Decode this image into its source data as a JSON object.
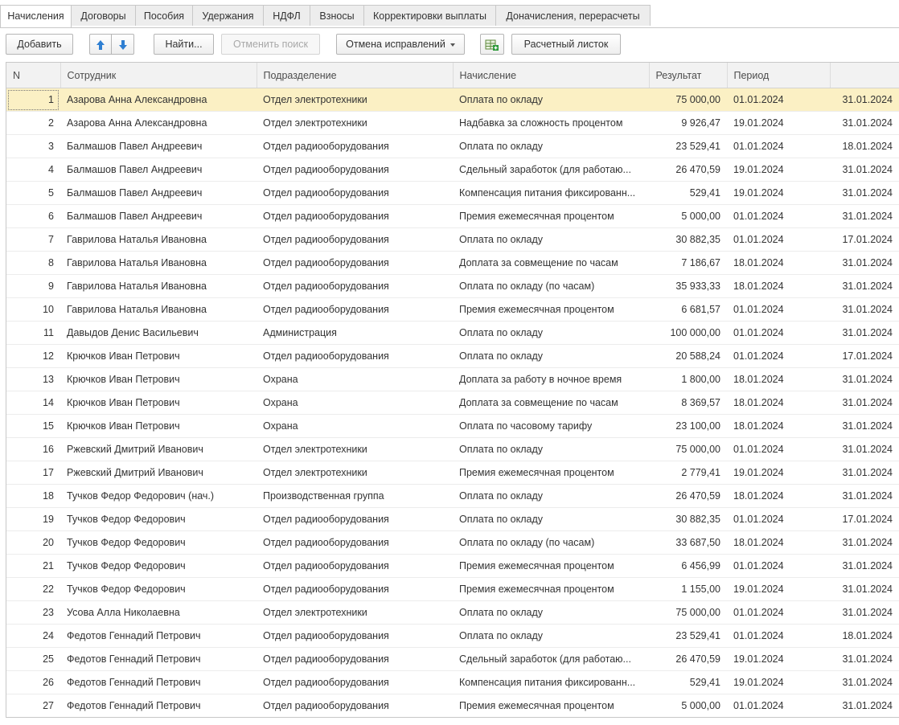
{
  "tabs": [
    "Начисления",
    "Договоры",
    "Пособия",
    "Удержания",
    "НДФЛ",
    "Взносы",
    "Корректировки выплаты",
    "Доначисления, перерасчеты"
  ],
  "toolbar": {
    "add": "Добавить",
    "find": "Найти...",
    "cancel_search": "Отменить поиск",
    "cancel_corrections": "Отмена исправлений",
    "payslip": "Расчетный листок",
    "icons": [
      "arrow-up-icon",
      "arrow-down-icon",
      "table-add-icon",
      "chevron-down-icon"
    ]
  },
  "columns": [
    "N",
    "Сотрудник",
    "Подразделение",
    "Начисление",
    "Результат",
    "Период",
    ""
  ],
  "colors": {
    "selected_row": "#fbf0c4",
    "arrow_blue": "#2f7fd2",
    "tab_bg": "#ededed"
  },
  "rows": [
    [
      "1",
      "Азарова Анна Александровна",
      "Отдел электротехники",
      "Оплата по окладу",
      "75 000,00",
      "01.01.2024",
      "31.01.2024"
    ],
    [
      "2",
      "Азарова Анна Александровна",
      "Отдел электротехники",
      "Надбавка за сложность процентом",
      "9 926,47",
      "19.01.2024",
      "31.01.2024"
    ],
    [
      "3",
      "Балмашов Павел Андреевич",
      "Отдел радиооборудования",
      "Оплата по окладу",
      "23 529,41",
      "01.01.2024",
      "18.01.2024"
    ],
    [
      "4",
      "Балмашов Павел Андреевич",
      "Отдел радиооборудования",
      "Сдельный заработок (для работаю...",
      "26 470,59",
      "19.01.2024",
      "31.01.2024"
    ],
    [
      "5",
      "Балмашов Павел Андреевич",
      "Отдел радиооборудования",
      "Компенсация питания фиксированн...",
      "529,41",
      "19.01.2024",
      "31.01.2024"
    ],
    [
      "6",
      "Балмашов Павел Андреевич",
      "Отдел радиооборудования",
      "Премия ежемесячная процентом",
      "5 000,00",
      "01.01.2024",
      "31.01.2024"
    ],
    [
      "7",
      "Гаврилова Наталья Ивановна",
      "Отдел радиооборудования",
      "Оплата по окладу",
      "30 882,35",
      "01.01.2024",
      "17.01.2024"
    ],
    [
      "8",
      "Гаврилова Наталья Ивановна",
      "Отдел радиооборудования",
      "Доплата за совмещение по часам",
      "7 186,67",
      "18.01.2024",
      "31.01.2024"
    ],
    [
      "9",
      "Гаврилова Наталья Ивановна",
      "Отдел радиооборудования",
      "Оплата по окладу (по часам)",
      "35 933,33",
      "18.01.2024",
      "31.01.2024"
    ],
    [
      "10",
      "Гаврилова Наталья Ивановна",
      "Отдел радиооборудования",
      "Премия ежемесячная процентом",
      "6 681,57",
      "01.01.2024",
      "31.01.2024"
    ],
    [
      "11",
      "Давыдов Денис Васильевич",
      "Администрация",
      "Оплата по окладу",
      "100 000,00",
      "01.01.2024",
      "31.01.2024"
    ],
    [
      "12",
      "Крючков Иван Петрович",
      "Отдел радиооборудования",
      "Оплата по окладу",
      "20 588,24",
      "01.01.2024",
      "17.01.2024"
    ],
    [
      "13",
      "Крючков Иван Петрович",
      "Охрана",
      "Доплата за работу в ночное время",
      "1 800,00",
      "18.01.2024",
      "31.01.2024"
    ],
    [
      "14",
      "Крючков Иван Петрович",
      "Охрана",
      "Доплата за совмещение по часам",
      "8 369,57",
      "18.01.2024",
      "31.01.2024"
    ],
    [
      "15",
      "Крючков Иван Петрович",
      "Охрана",
      "Оплата по часовому тарифу",
      "23 100,00",
      "18.01.2024",
      "31.01.2024"
    ],
    [
      "16",
      "Ржевский Дмитрий Иванович",
      "Отдел электротехники",
      "Оплата по окладу",
      "75 000,00",
      "01.01.2024",
      "31.01.2024"
    ],
    [
      "17",
      "Ржевский Дмитрий Иванович",
      "Отдел электротехники",
      "Премия ежемесячная процентом",
      "2 779,41",
      "19.01.2024",
      "31.01.2024"
    ],
    [
      "18",
      "Тучков Федор Федорович (нач.)",
      "Производственная группа",
      "Оплата по окладу",
      "26 470,59",
      "18.01.2024",
      "31.01.2024"
    ],
    [
      "19",
      "Тучков Федор Федорович",
      "Отдел радиооборудования",
      "Оплата по окладу",
      "30 882,35",
      "01.01.2024",
      "17.01.2024"
    ],
    [
      "20",
      "Тучков Федор Федорович",
      "Отдел радиооборудования",
      "Оплата по окладу (по часам)",
      "33 687,50",
      "18.01.2024",
      "31.01.2024"
    ],
    [
      "21",
      "Тучков Федор Федорович",
      "Отдел радиооборудования",
      "Премия ежемесячная процентом",
      "6 456,99",
      "01.01.2024",
      "31.01.2024"
    ],
    [
      "22",
      "Тучков Федор Федорович",
      "Отдел радиооборудования",
      "Премия ежемесячная процентом",
      "1 155,00",
      "19.01.2024",
      "31.01.2024"
    ],
    [
      "23",
      "Усова Алла Николаевна",
      "Отдел электротехники",
      "Оплата по окладу",
      "75 000,00",
      "01.01.2024",
      "31.01.2024"
    ],
    [
      "24",
      "Федотов Геннадий Петрович",
      "Отдел радиооборудования",
      "Оплата по окладу",
      "23 529,41",
      "01.01.2024",
      "18.01.2024"
    ],
    [
      "25",
      "Федотов Геннадий Петрович",
      "Отдел радиооборудования",
      "Сдельный заработок (для работаю...",
      "26 470,59",
      "19.01.2024",
      "31.01.2024"
    ],
    [
      "26",
      "Федотов Геннадий Петрович",
      "Отдел радиооборудования",
      "Компенсация питания фиксированн...",
      "529,41",
      "19.01.2024",
      "31.01.2024"
    ],
    [
      "27",
      "Федотов Геннадий Петрович",
      "Отдел радиооборудования",
      "Премия ежемесячная процентом",
      "5 000,00",
      "01.01.2024",
      "31.01.2024"
    ]
  ]
}
